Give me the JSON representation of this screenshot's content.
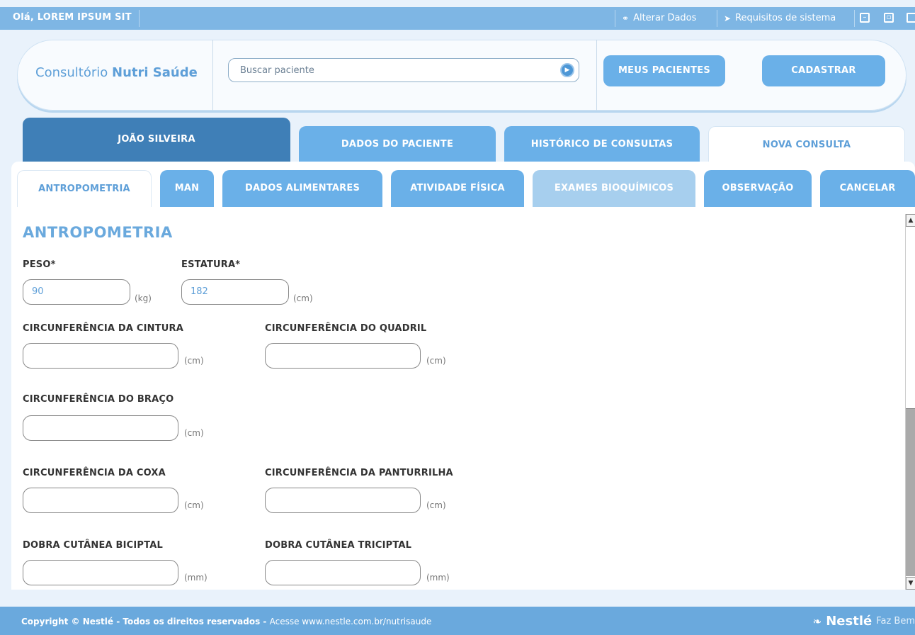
{
  "topbar": {
    "greeting": "Olá, LOREM IPSUM SIT",
    "alterar": "Alterar Dados",
    "requisitos": "Requisitos de sistema",
    "alterar_icon": "users-icon",
    "requisitos_icon": "tag-icon"
  },
  "header": {
    "brand_regular": "Consultório",
    "brand_bold": "Nutri Saúde",
    "search_placeholder": "Buscar paciente",
    "btn_meus": "MEUS PACIENTES",
    "btn_cadastrar": "CADASTRAR"
  },
  "patient_tabs": {
    "name": "JOÃO SILVEIRA",
    "dados": "DADOS DO PACIENTE",
    "historico": "HISTÓRICO DE CONSULTAS",
    "nova": "NOVA CONSULTA"
  },
  "section_tabs": [
    "ANTROPOMETRIA",
    "MAN",
    "DADOS ALIMENTARES",
    "ATIVIDADE FÍSICA",
    "EXAMES BIOQUÍMICOS",
    "OBSERVAÇÃO",
    "CANCELAR"
  ],
  "form": {
    "title": "ANTROPOMETRIA",
    "peso_label": "PESO*",
    "peso_value": "90",
    "peso_unit": "(kg)",
    "estatura_label": "ESTATURA*",
    "estatura_value": "182",
    "estatura_unit": "(cm)",
    "cintura_label": "CIRCUNFERÊNCIA DA CINTURA",
    "quadril_label": "CIRCUNFERÊNCIA DO QUADRIL",
    "braco_label": "CIRCUNFERÊNCIA DO BRAÇO",
    "coxa_label": "CIRCUNFERÊNCIA DA COXA",
    "panturrilha_label": "CIRCUNFERÊNCIA DA PANTURRILHA",
    "bicipital_label": "DOBRA CUTÂNEA BICIPTAL",
    "tricipital_label": "DOBRA CUTÂNEA TRICIPTAL",
    "unit_cm": "(cm)",
    "unit_mm": "(mm)"
  },
  "footer": {
    "copyright": "Copyright © Nestlé - Todos os direitos reservados -",
    "site": "Acesse www.nestle.com.br/nutrisaude",
    "brand": "Nestlé",
    "slogan": "Faz Bem"
  },
  "colors": {
    "accent": "#6ab0e8",
    "topbar": "#7eb6e4",
    "active_patient_tab": "#3f7fb7",
    "footer": "#6aa9dd"
  }
}
